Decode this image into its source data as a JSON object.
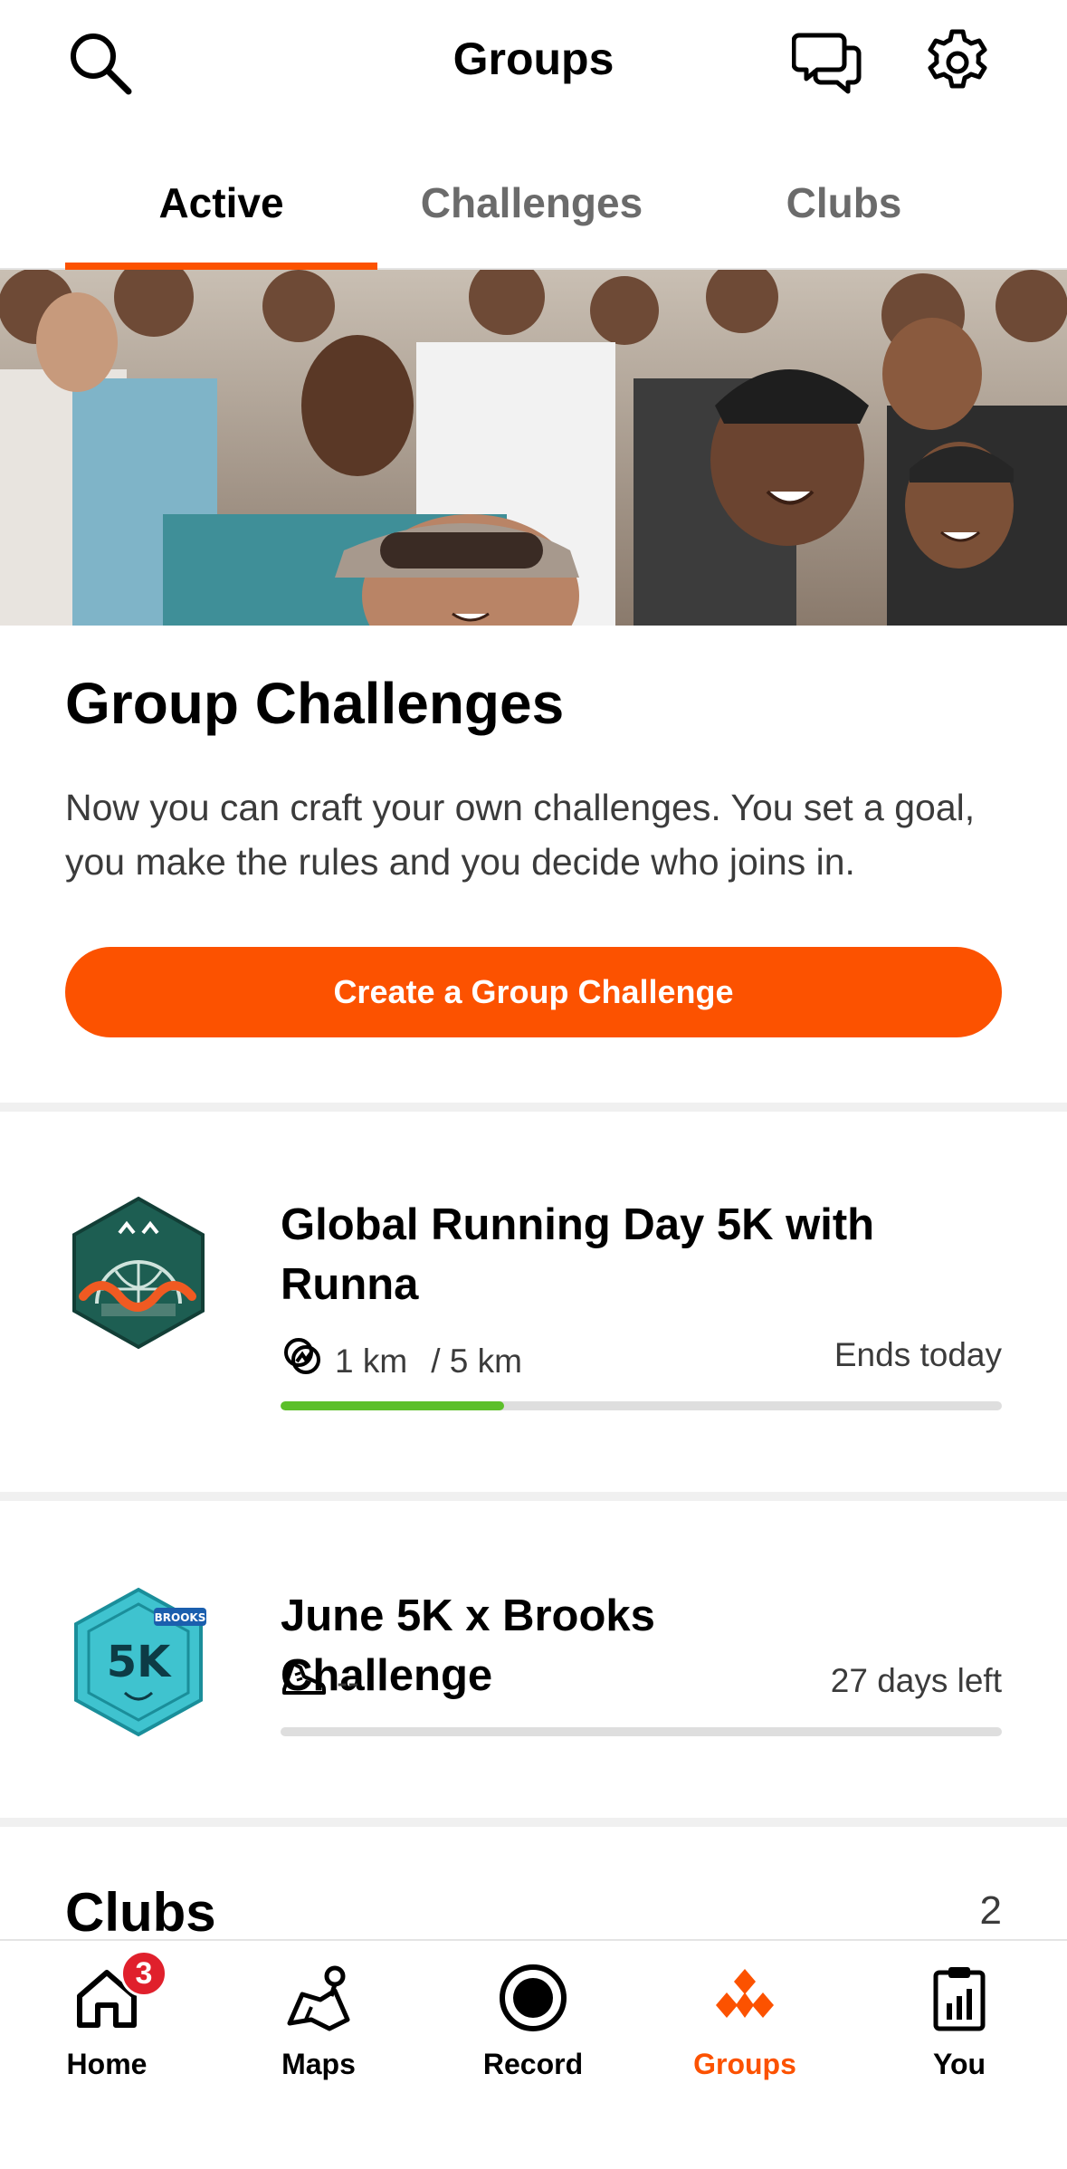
{
  "header": {
    "title": "Groups",
    "icons": [
      "search-icon",
      "chat-icon",
      "gear-icon"
    ]
  },
  "tabs": [
    {
      "label": "Active",
      "active": true
    },
    {
      "label": "Challenges",
      "active": false
    },
    {
      "label": "Clubs",
      "active": false
    }
  ],
  "group_challenges": {
    "title": "Group Challenges",
    "description": "Now you can craft your own challenges. You set a goal, you make the rules and you decide who joins in.",
    "button_label": "Create a Group Challenge"
  },
  "challenges": [
    {
      "title": "Global Running Day 5K with Runna",
      "progress_value": "1 km",
      "progress_goal": "/ 5 km",
      "time_left": "Ends today",
      "progress_fraction": 0.31,
      "icon": "activity-rings-icon"
    },
    {
      "title": "June 5K x Brooks Challenge",
      "progress_value": "--",
      "time_left": "27 days left",
      "progress_fraction": 0,
      "icon": "running-shoe-icon",
      "badge_text": "5K",
      "badge_brand": "BROOKS"
    }
  ],
  "clubs": {
    "title": "Clubs",
    "count": "2"
  },
  "bottom_nav": [
    {
      "label": "Home",
      "badge": "3",
      "icon": "home-icon"
    },
    {
      "label": "Maps",
      "icon": "map-icon"
    },
    {
      "label": "Record",
      "icon": "record-icon"
    },
    {
      "label": "Groups",
      "icon": "groups-icon",
      "active": true
    },
    {
      "label": "You",
      "icon": "clipboard-stats-icon"
    }
  ],
  "colors": {
    "accent": "#fc5200",
    "progress_green": "#5cbf2a",
    "notification_red": "#e0202c"
  }
}
